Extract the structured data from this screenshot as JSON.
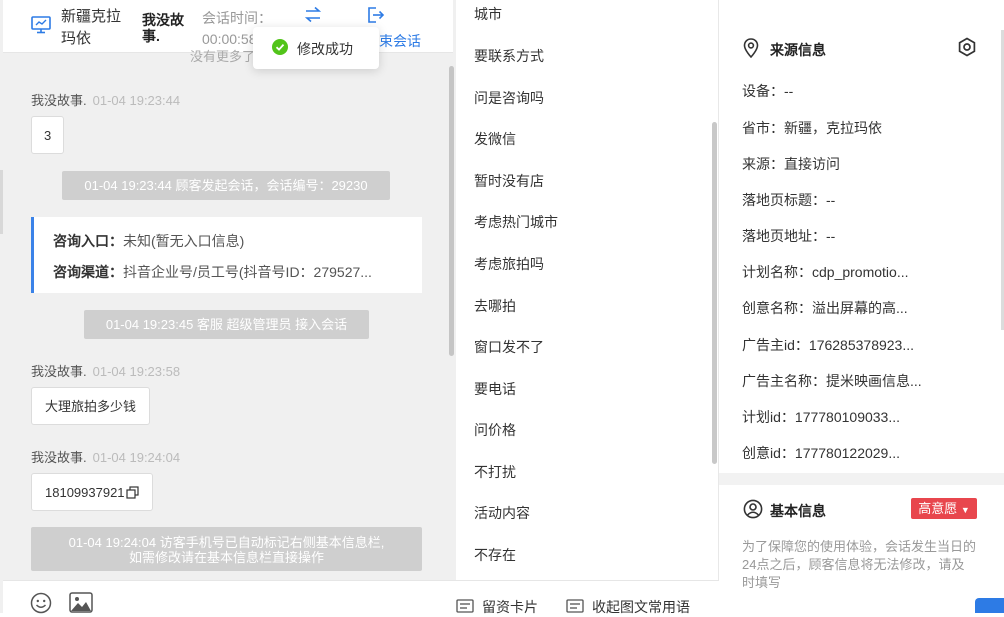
{
  "chat_header": {
    "location": "新疆克拉玛依",
    "visitor_name": "我没故事.",
    "session_time_label": "会话时间：",
    "session_time_value": "00:00:58",
    "end_session_label": "结束会话"
  },
  "toast": {
    "text": "修改成功"
  },
  "chat": {
    "more_hint": "没有更多了",
    "messages": [
      {
        "sender": "我没故事.",
        "time": "01-04 19:23:44",
        "text": "3"
      },
      {
        "sender": "我没故事.",
        "time": "01-04 19:23:58",
        "text": "大理旅拍多少钱"
      },
      {
        "sender": "我没故事.",
        "time": "01-04 19:24:04",
        "text": "18109937921"
      }
    ],
    "system": [
      "01-04 19:23:44 顾客发起会话，会话编号：29230",
      "01-04 19:23:45 客服 超级管理员 接入会话"
    ],
    "system_notice_line1": "01-04 19:24:04 访客手机号已自动标记右侧基本信息栏,",
    "system_notice_line2": "如需修改请在基本信息栏直接操作",
    "entry": {
      "entrance_label": "咨询入口：",
      "entrance_value": "未知(暂无入口信息)",
      "channel_label": "咨询渠道：",
      "channel_value": "抖音企业号/员工号(抖音号ID：279527..."
    }
  },
  "quick_replies": {
    "items": [
      "城市",
      "要联系方式",
      "问是咨询吗",
      "发微信",
      "暂时没有店",
      "考虑热门城市",
      "考虑旅拍吗",
      "去哪拍",
      "窗口发不了",
      "要电话",
      "问价格",
      "不打扰",
      "活动内容",
      "不存在"
    ],
    "bottom": {
      "card_label": "留资卡片",
      "collect_label": "收起图文常用语"
    }
  },
  "info_panel": {
    "source_title": "来源信息",
    "source_fields": [
      {
        "label": "设备：",
        "value": "--"
      },
      {
        "label": "省市：",
        "value": "新疆，克拉玛依"
      },
      {
        "label": "来源：",
        "value": "直接访问"
      },
      {
        "label": "落地页标题：",
        "value": "--"
      },
      {
        "label": "落地页地址：",
        "value": "--"
      },
      {
        "label": "计划名称：",
        "value": "cdp_promotio..."
      },
      {
        "label": "创意名称：",
        "value": "溢出屏幕的高..."
      },
      {
        "label": "广告主id：",
        "value": "176285378923..."
      },
      {
        "label": "广告主名称：",
        "value": "提米映画信息..."
      },
      {
        "label": "计划id：",
        "value": "177780109033..."
      },
      {
        "label": "创意id：",
        "value": "177780122029..."
      }
    ],
    "basic_title": "基本信息",
    "intent_badge": "高意愿",
    "notice": "为了保障您的使用体验，会话发生当日的24点之后，顾客信息将无法修改，请及时填写"
  },
  "colors": {
    "accent": "#2d7be5",
    "intent_badge": "#e8464d",
    "toast_success": "#52c41a"
  }
}
